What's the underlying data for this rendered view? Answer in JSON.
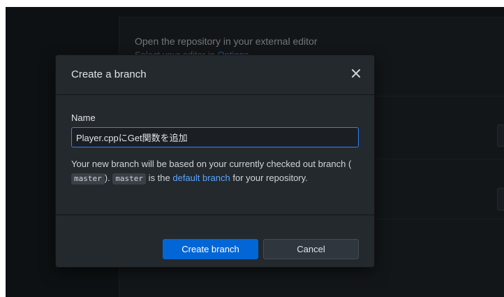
{
  "background": {
    "editor_title": "Open the repository in your external editor",
    "editor_sub_prefix": "Select your editor in ",
    "editor_sub_link": "Options"
  },
  "dialog": {
    "title": "Create a branch",
    "name_label": "Name",
    "name_value": "Player.cppにGet関数を追加",
    "desc_part1": "Your new branch will be based on your currently checked out branch (",
    "base_branch": "master",
    "desc_part2": "). ",
    "default_branch_code": "master",
    "desc_part3": " is the ",
    "default_branch_link": "default branch",
    "desc_part4": " for your repository.",
    "create_button": "Create branch",
    "cancel_button": "Cancel"
  },
  "colors": {
    "accent": "#0366d6",
    "link": "#58a6ff",
    "focus": "#2f81f7"
  }
}
